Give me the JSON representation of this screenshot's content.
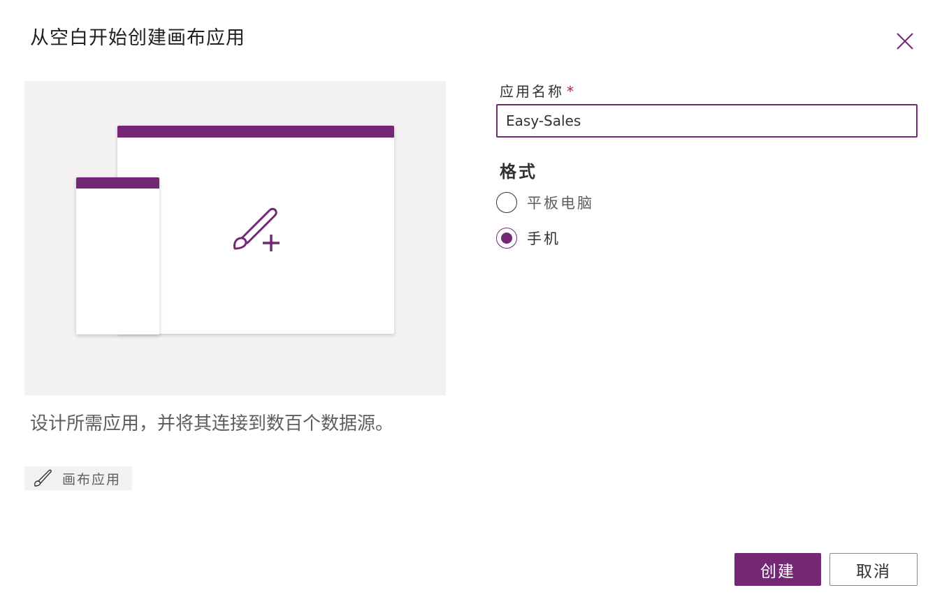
{
  "dialog": {
    "title": "从空白开始创建画布应用",
    "close_icon": "close-icon"
  },
  "preview": {
    "accent_color": "#742774",
    "icon": "paintbrush-plus-icon",
    "description": "设计所需应用，并将其连接到数百个数据源。",
    "tag": {
      "icon": "paintbrush-icon",
      "label": "画布应用"
    }
  },
  "form": {
    "name_label": "应用名称",
    "required_marker": "*",
    "name_value": "Easy-Sales",
    "format_title": "格式",
    "format_options": [
      {
        "label": "平板电脑",
        "selected": false
      },
      {
        "label": "手机",
        "selected": true
      }
    ]
  },
  "actions": {
    "create_label": "创建",
    "cancel_label": "取消"
  }
}
